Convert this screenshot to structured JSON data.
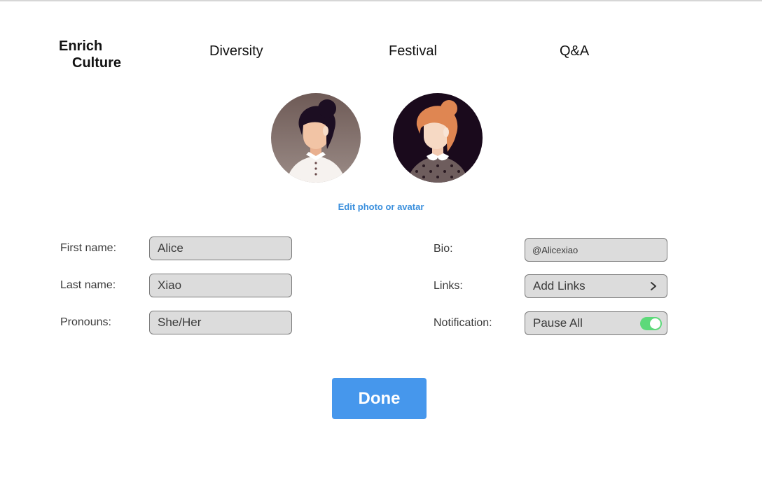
{
  "header": {
    "logo_line1": "Enrich",
    "logo_line2": "Culture",
    "nav": [
      "Diversity",
      "Festival",
      "Q&A"
    ]
  },
  "avatars": {
    "edit_label": "Edit photo or avatar"
  },
  "form": {
    "first_name": {
      "label": "First name:",
      "value": "Alice"
    },
    "last_name": {
      "label": "Last name:",
      "value": "Xiao"
    },
    "pronouns": {
      "label": "Pronouns:",
      "value": "She/Her"
    },
    "bio": {
      "label": "Bio:",
      "value": "@Alicexiao"
    },
    "links": {
      "label": "Links:",
      "value": "Add Links"
    },
    "notification": {
      "label": "Notification:",
      "value": "Pause All",
      "toggle_on": true
    }
  },
  "actions": {
    "done_label": "Done"
  },
  "colors": {
    "accent": "#4697ec",
    "link": "#3a8fdd",
    "toggle": "#5dd97a",
    "field_bg": "#dcdcdc"
  }
}
